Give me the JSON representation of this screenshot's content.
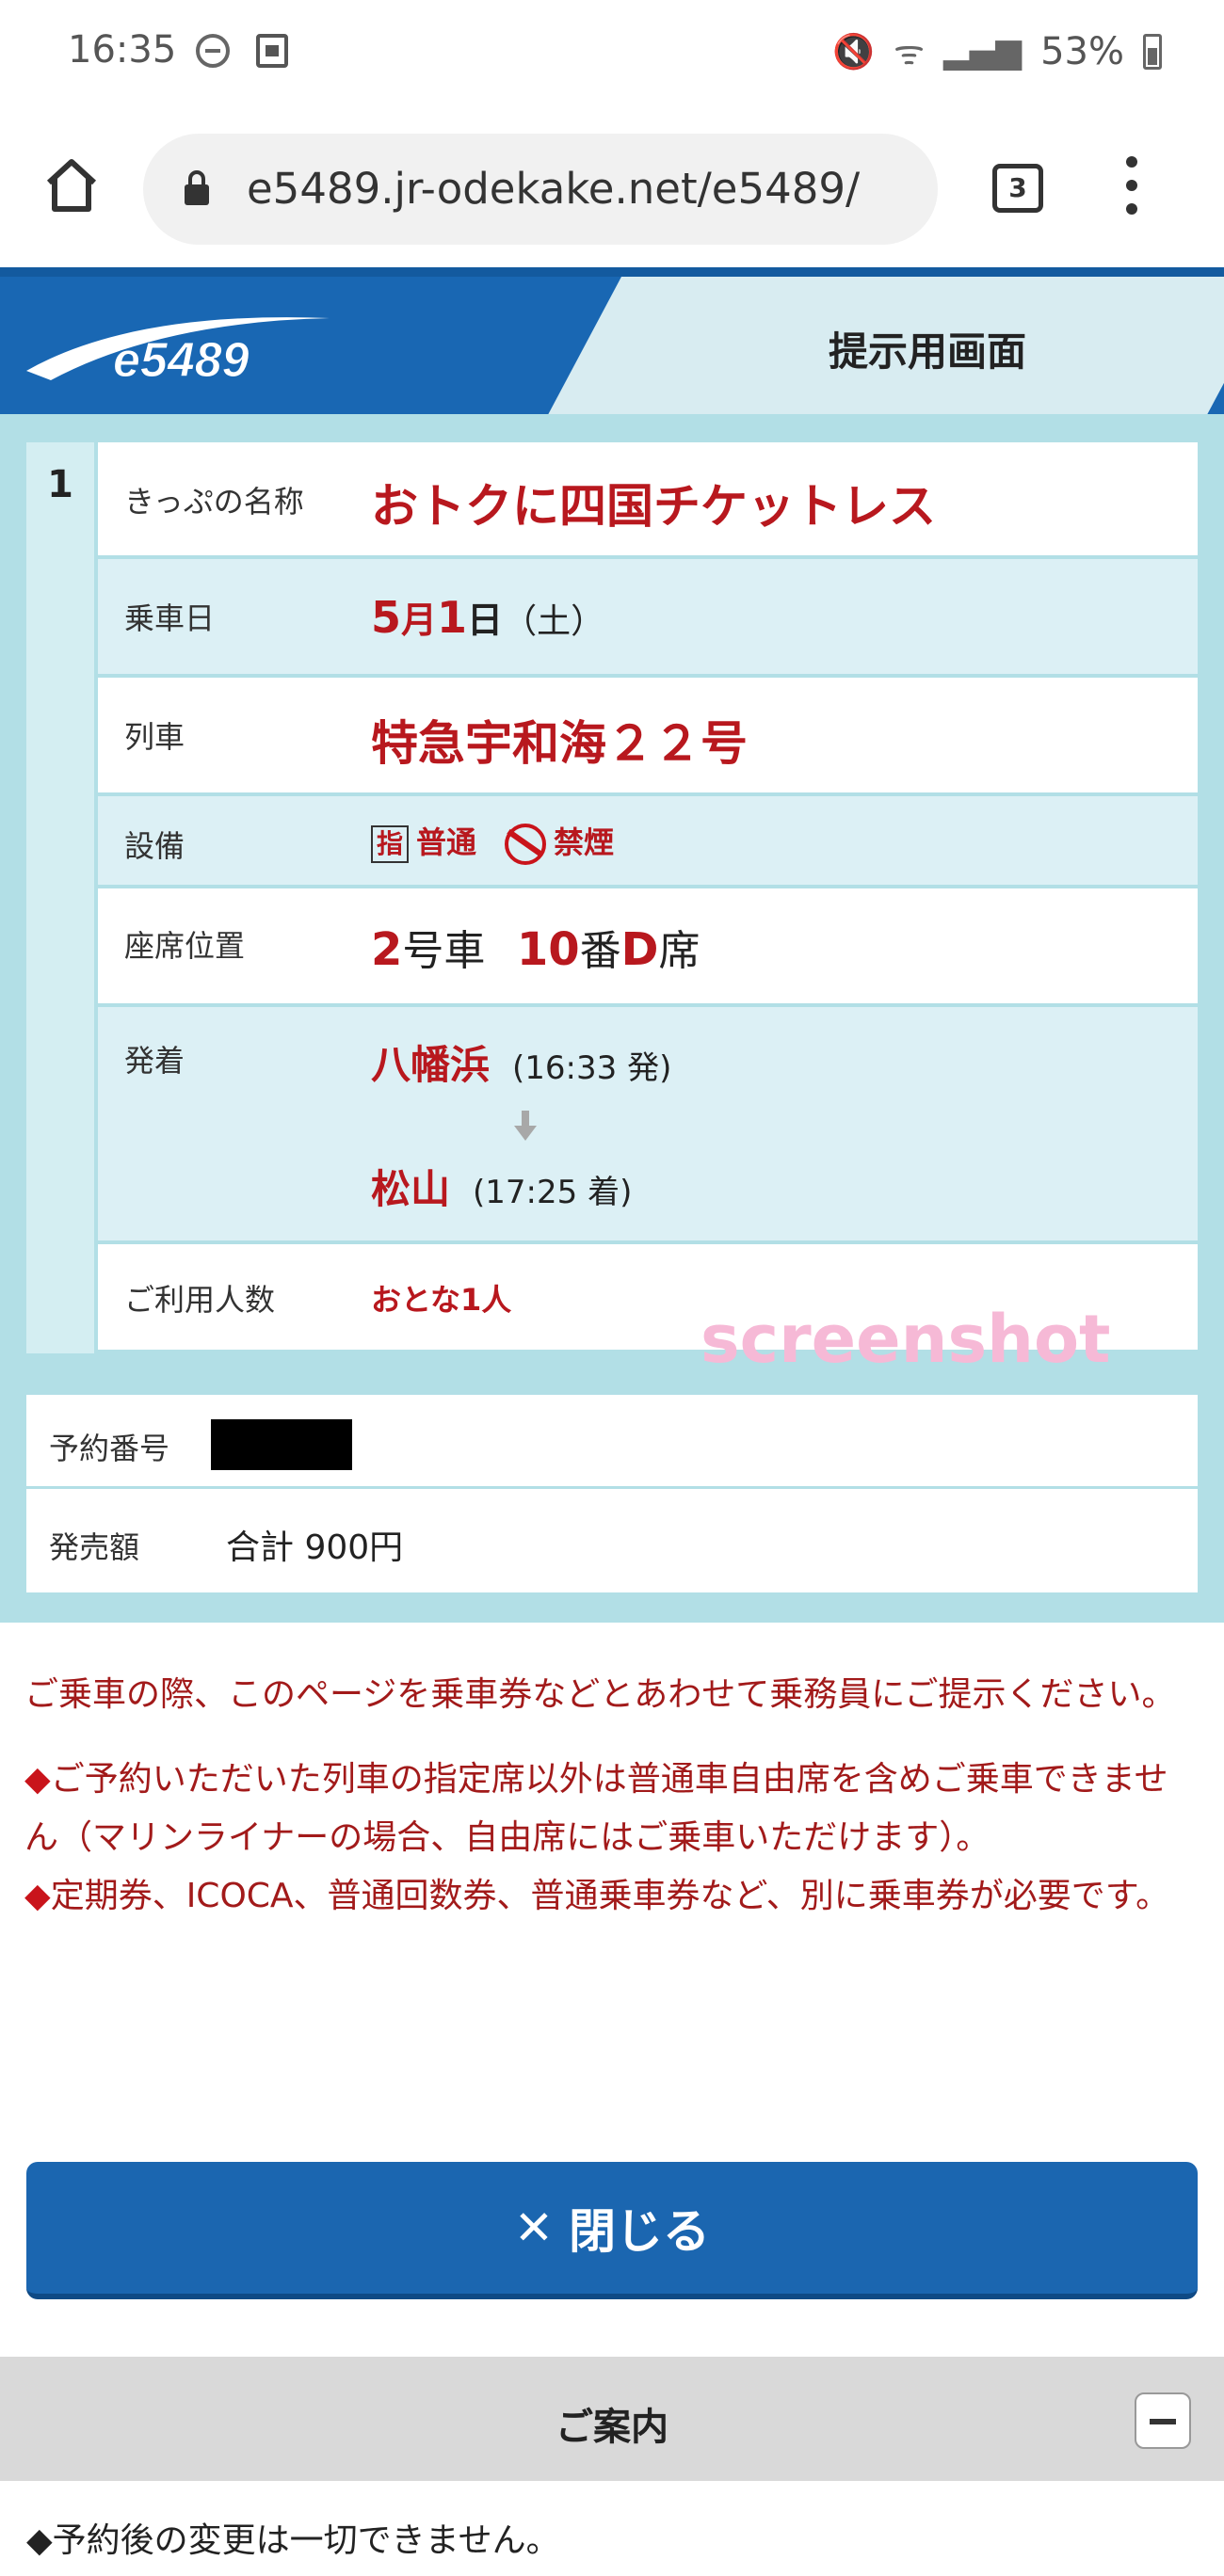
{
  "status_bar": {
    "time": "16:35",
    "battery": "53%"
  },
  "browser": {
    "url": "e5489.jr-odekake.net/e5489/",
    "tab_count": "3"
  },
  "header": {
    "logo_text": "e5489",
    "title": "提示用画面"
  },
  "ticket": {
    "number": "1",
    "rows": {
      "name": {
        "label": "きっぷの名称",
        "value": "おトクに四国チケットレス"
      },
      "date": {
        "label": "乗車日",
        "month": "5",
        "month_unit": "月",
        "day": "1",
        "day_unit": "日",
        "weekday": "（土）"
      },
      "train": {
        "label": "列車",
        "value": "特急宇和海２２号"
      },
      "facility": {
        "label": "設備",
        "reserved_mark": "指",
        "class": "普通",
        "smoking": "禁煙"
      },
      "seat": {
        "label": "座席位置",
        "car": "2",
        "car_unit": "号車",
        "row": "10",
        "row_unit": "番",
        "seat": "D",
        "seat_unit": "席"
      },
      "route": {
        "label": "発着",
        "from": "八幡浜",
        "from_time": "(16:33 発)",
        "to": "松山",
        "to_time": "(17:25 着)"
      },
      "passengers": {
        "label": "ご利用人数",
        "value": "おとな1人"
      }
    }
  },
  "watermark": "screenshot",
  "reservation": {
    "number_label": "予約番号",
    "amount_label": "発売額",
    "amount_value": "合計 900円"
  },
  "notes": [
    "ご乗車の際、このページを乗車券などとあわせて乗務員にご提示ください。",
    "ご予約いただいた列車の指定席以外は普通車自由席を含めご乗車できません（マリンライナーの場合、自由席にはご乗車いただけます）。",
    "定期券、ICOCA、普通回数券、普通乗車券など、別に乗車券が必要です。"
  ],
  "note_bullet": "◆",
  "close_button": {
    "label": "閉じる",
    "icon": "close-icon"
  },
  "guide": {
    "title": "ご案内",
    "item": "◆予約後の変更は一切できません。"
  },
  "colors": {
    "brand_blue": "#1967b3",
    "accent_red": "#b8181e",
    "panel_bg": "#b2dfe6"
  }
}
